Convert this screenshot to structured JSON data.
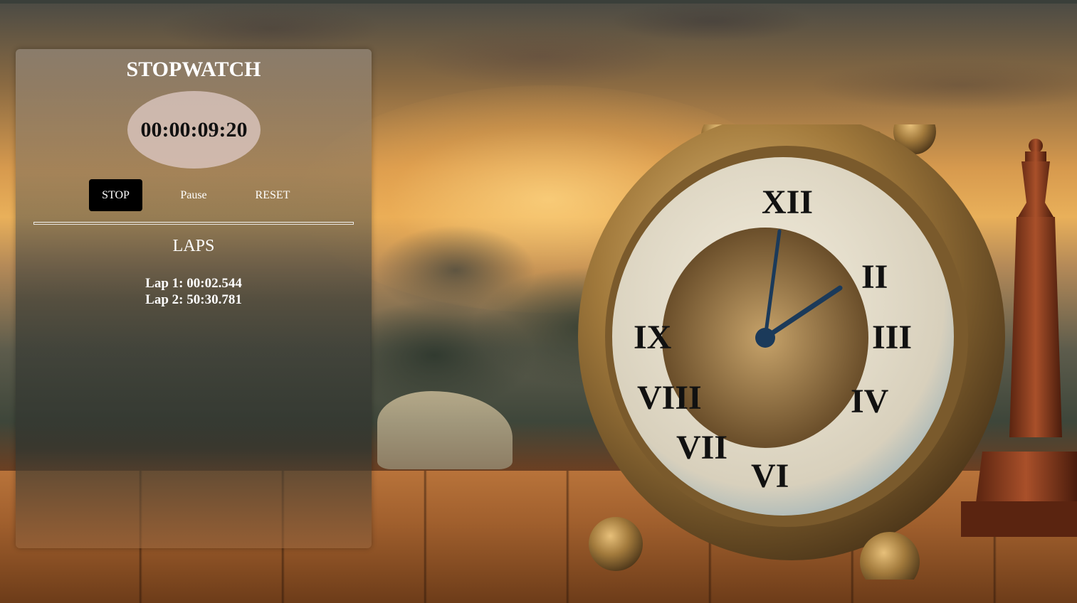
{
  "stopwatch": {
    "title": "STOPWATCH",
    "time_display": "00:00:09:20",
    "buttons": {
      "stop_label": "STOP",
      "pause_label": "Pause",
      "reset_label": "RESET"
    },
    "laps": {
      "title": "LAPS",
      "items": [
        "Lap 1: 00:02.544",
        "Lap 2: 50:30.781"
      ]
    }
  },
  "colors": {
    "panel_text": "#ffffff",
    "stop_button_bg": "#000000",
    "display_bg": "#dcc8c3",
    "display_text": "#111111"
  },
  "background": {
    "icon": "alarm-clock-landscape-icon"
  }
}
